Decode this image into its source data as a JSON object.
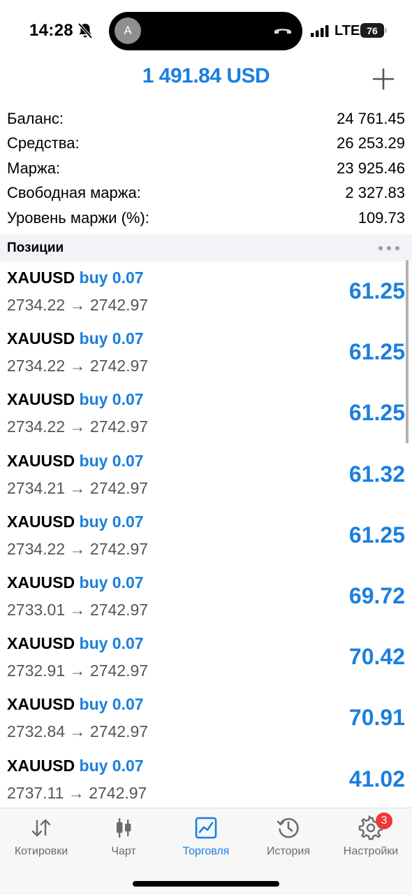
{
  "status_bar": {
    "time": "14:28",
    "network": "LTE",
    "battery": "76",
    "caller_initial": "A"
  },
  "header": {
    "balance_display": "1 491.84 USD"
  },
  "summary": [
    {
      "label": "Баланс:",
      "value": "24 761.45"
    },
    {
      "label": "Средства:",
      "value": "26 253.29"
    },
    {
      "label": "Маржа:",
      "value": "23 925.46"
    },
    {
      "label": "Свободная маржа:",
      "value": "2 327.83"
    },
    {
      "label": "Уровень маржи (%):",
      "value": "109.73"
    }
  ],
  "positions_section": {
    "title": "Позиции"
  },
  "positions": [
    {
      "symbol": "XAUUSD",
      "type": "buy 0.07",
      "prices": "2734.22 → 2742.97",
      "profit": "61.25"
    },
    {
      "symbol": "XAUUSD",
      "type": "buy 0.07",
      "prices": "2734.22 → 2742.97",
      "profit": "61.25"
    },
    {
      "symbol": "XAUUSD",
      "type": "buy 0.07",
      "prices": "2734.22 → 2742.97",
      "profit": "61.25"
    },
    {
      "symbol": "XAUUSD",
      "type": "buy 0.07",
      "prices": "2734.21 → 2742.97",
      "profit": "61.32"
    },
    {
      "symbol": "XAUUSD",
      "type": "buy 0.07",
      "prices": "2734.22 → 2742.97",
      "profit": "61.25"
    },
    {
      "symbol": "XAUUSD",
      "type": "buy 0.07",
      "prices": "2733.01 → 2742.97",
      "profit": "69.72"
    },
    {
      "symbol": "XAUUSD",
      "type": "buy 0.07",
      "prices": "2732.91 → 2742.97",
      "profit": "70.42"
    },
    {
      "symbol": "XAUUSD",
      "type": "buy 0.07",
      "prices": "2732.84 → 2742.97",
      "profit": "70.91"
    },
    {
      "symbol": "XAUUSD",
      "type": "buy 0.07",
      "prices": "2737.11 → 2742.97",
      "profit": "41.02"
    }
  ],
  "tabs": [
    {
      "label": "Котировки",
      "icon": "quotes-arrows-icon",
      "active": false
    },
    {
      "label": "Чарт",
      "icon": "candlestick-chart-icon",
      "active": false
    },
    {
      "label": "Торговля",
      "icon": "trade-chart-icon",
      "active": true
    },
    {
      "label": "История",
      "icon": "history-clock-icon",
      "active": false
    },
    {
      "label": "Настройки",
      "icon": "settings-gear-icon",
      "active": false,
      "badge": "3"
    }
  ],
  "colors": {
    "accent": "#1a7fe0",
    "badge": "#f0383a"
  }
}
